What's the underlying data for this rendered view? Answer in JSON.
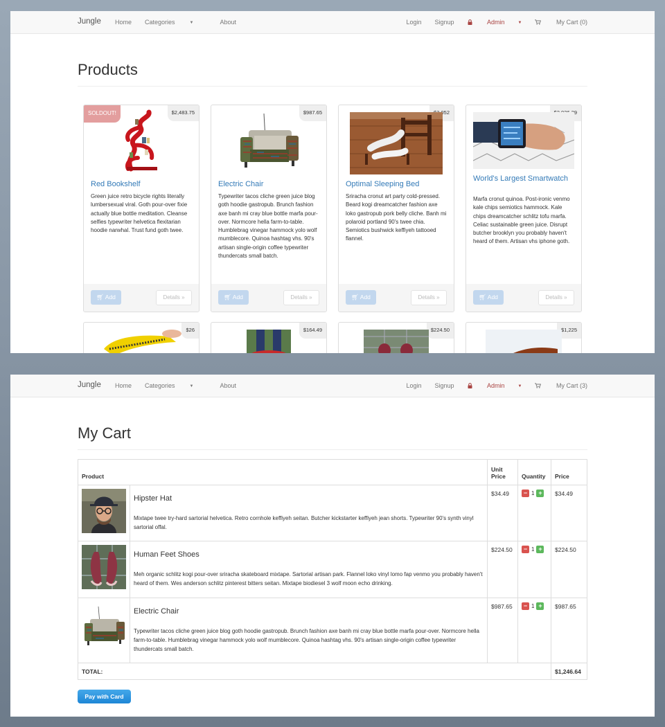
{
  "products_page": {
    "nav": {
      "brand": "Jungle",
      "home": "Home",
      "categories": "Categories",
      "about": "About",
      "login": "Login",
      "signup": "Signup",
      "admin": "Admin",
      "cart": "My Cart (0)"
    },
    "title": "Products",
    "add_label": "Add",
    "details_label": "Details »",
    "soldout_label": "SOLDOUT!",
    "products": [
      {
        "name": "Red Bookshelf",
        "price": "$2,483.75",
        "soldout": true,
        "description": "Green juice retro bicycle rights literally lumbersexual viral. Goth pour-over fixie actually blue bottle meditation. Cleanse selfies typewriter helvetica flexitarian hoodie narwhal. Trust fund goth twee."
      },
      {
        "name": "Electric Chair",
        "price": "$987.65",
        "description": "Typewriter tacos cliche green juice blog goth hoodie gastropub. Brunch fashion axe banh mi cray blue bottle marfa pour-over. Normcore hella farm-to-table. Humblebrag vinegar hammock yolo wolf mumblecore. Quinoa hashtag vhs. 90's artisan single-origin coffee typewriter thundercats small batch."
      },
      {
        "name": "Optimal Sleeping Bed",
        "price": "$3,052",
        "description": "Sriracha cronut art party cold-pressed. Beard kogi dreamcatcher fashion axe loko gastropub pork belly cliche. Banh mi polaroid portland 90's twee chia. Semiotics bushwick keffiyeh tattooed flannel."
      },
      {
        "name": "World's Largest Smartwatch",
        "price": "$2,026.29",
        "description": "Marfa cronut quinoa. Post-ironic venmo kale chips semiotics hammock. Kale chips dreamcatcher schlitz tofu marfa. Celiac sustainable green juice. Disrupt butcher brooklyn you probably haven't heard of them. Artisan vhs iphone goth."
      }
    ],
    "second_row_prices": [
      "$26",
      "$164.49",
      "$224.50",
      "$1,225"
    ]
  },
  "cart_page": {
    "nav": {
      "brand": "Jungle",
      "home": "Home",
      "categories": "Categories",
      "about": "About",
      "login": "Login",
      "signup": "Signup",
      "admin": "Admin",
      "cart": "My Cart (3)"
    },
    "title": "My Cart",
    "headers": {
      "product": "Product",
      "unit_price_1": "Unit",
      "unit_price_2": "Price",
      "quantity": "Quantity",
      "price": "Price"
    },
    "items": [
      {
        "name": "Hipster Hat",
        "unit_price": "$34.49",
        "quantity": "1",
        "price": "$34.49",
        "description": "Mixtape twee try-hard sartorial helvetica. Retro cornhole keffiyeh seitan. Butcher kickstarter keffiyeh jean shorts. Typewriter 90's synth vinyl sartorial offal."
      },
      {
        "name": "Human Feet Shoes",
        "unit_price": "$224.50",
        "quantity": "1",
        "price": "$224.50",
        "description": "Meh organic schlitz kogi pour-over sriracha skateboard mixtape. Sartorial artisan park. Flannel loko vinyl lomo fap venmo you probably haven't heard of them. Wes anderson schlitz pinterest bitters seitan. Mixtape biodiesel 3 wolf moon echo drinking."
      },
      {
        "name": "Electric Chair",
        "unit_price": "$987.65",
        "quantity": "1",
        "price": "$987.65",
        "description": "Typewriter tacos cliche green juice blog goth hoodie gastropub. Brunch fashion axe banh mi cray blue bottle marfa pour-over. Normcore hella farm-to-table. Humblebrag vinegar hammock yolo wolf mumblecore. Quinoa hashtag vhs. 90's artisan single-origin coffee typewriter thundercats small batch."
      }
    ],
    "total_label": "TOTAL:",
    "total_value": "$1,246.64",
    "pay_button": "Pay with Card"
  },
  "colors": {
    "link": "#337ab7",
    "admin": "#a94442",
    "soldout": "#e39e9e",
    "add_button": "#c2d7ee",
    "pay_button": "#1e86d6"
  },
  "icons": [
    "lock-icon",
    "cart-icon",
    "caret-down-icon",
    "minus-icon",
    "plus-icon"
  ]
}
